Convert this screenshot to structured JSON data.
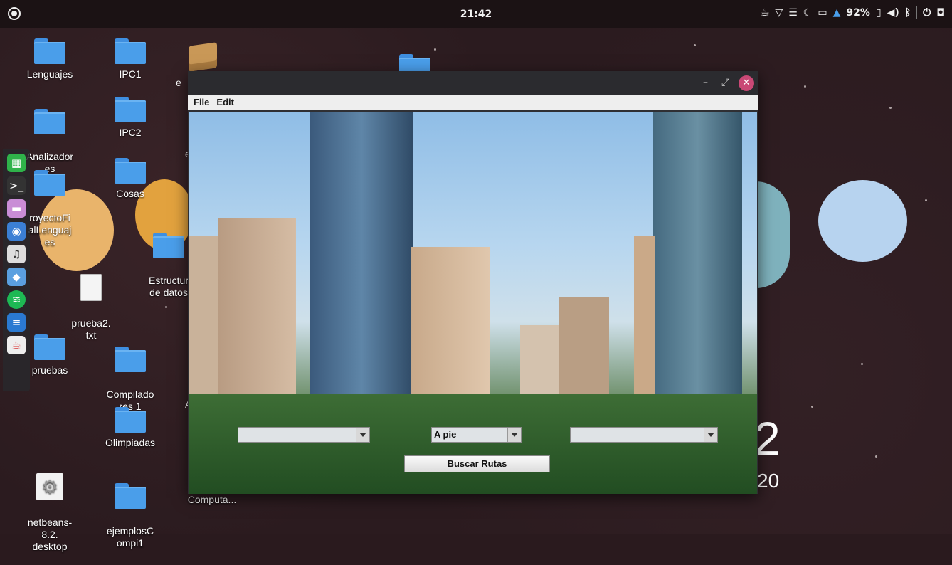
{
  "topbar": {
    "clock": "21:42",
    "battery": "92%"
  },
  "desktop": {
    "icons": [
      {
        "label": "Lenguajes"
      },
      {
        "label": "IPC1"
      },
      {
        "label": "Analizador\nes"
      },
      {
        "label": "IPC2"
      },
      {
        "label": "royectoFi\nalLenguaj\nes"
      },
      {
        "label": "Cosas"
      },
      {
        "label": "Estructur\nde datos"
      },
      {
        "label": "prueba2.\ntxt"
      },
      {
        "label": "pruebas"
      },
      {
        "label": "Compilado\nres 1"
      },
      {
        "label": "Olimpiadas"
      },
      {
        "label": "netbeans-\n8.2.\ndesktop"
      },
      {
        "label": "ejemplosC\nompi1"
      },
      {
        "label": "Computa..."
      }
    ],
    "partial_text": [
      "e",
      "e",
      "A",
      "2",
      "20"
    ]
  },
  "dock": {
    "apps": [
      "spreadsheet-icon",
      "terminal-icon",
      "files-icon",
      "chrome-icon",
      "music-icon",
      "virtualbox-icon",
      "spotify-icon",
      "text-editor-icon",
      "java-icon"
    ]
  },
  "window": {
    "menu": {
      "file": "File",
      "edit": "Edit"
    },
    "origin_combo": "",
    "mode_combo": "A pie",
    "destination_combo": "",
    "search_button": "Buscar Rutas"
  }
}
